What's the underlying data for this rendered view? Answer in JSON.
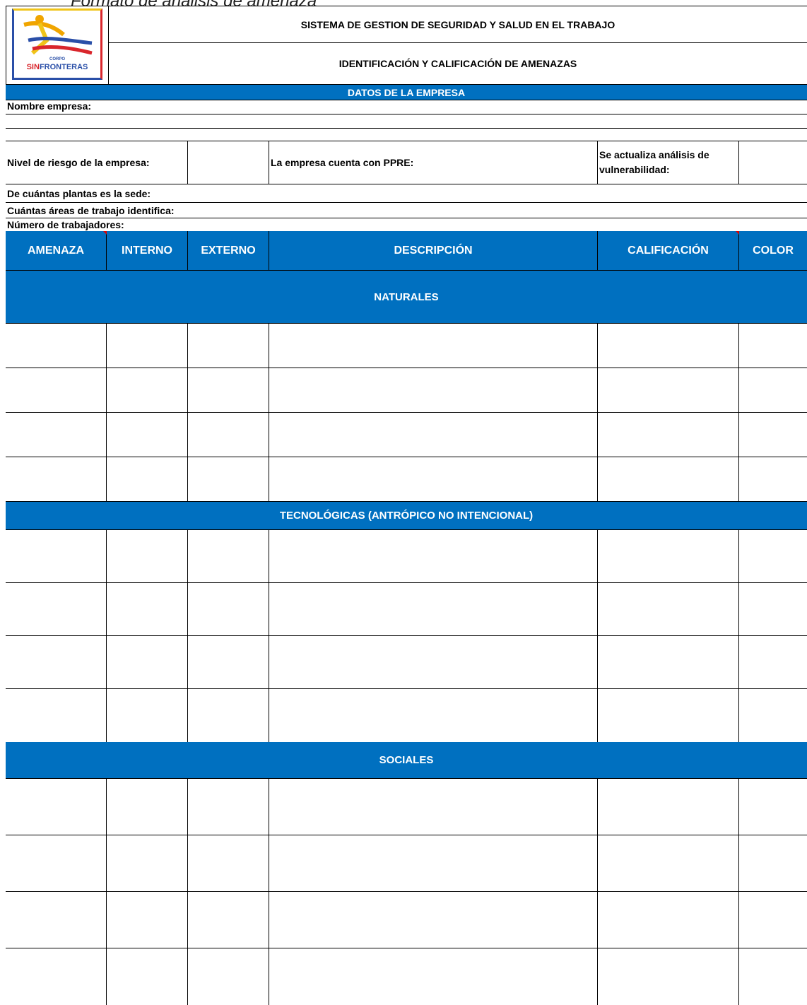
{
  "doc_title": "Formato de análisis de amenaza",
  "header": {
    "logo_small": "CORPO",
    "logo_sin": "SIN",
    "logo_fronteras": "FRONTERAS",
    "title": "SISTEMA DE GESTION DE SEGURIDAD Y SALUD EN EL TRABAJO",
    "subtitle": "IDENTIFICACIÓN Y CALIFICACIÓN DE AMENAZAS"
  },
  "company": {
    "section_title": "DATOS DE LA EMPRESA",
    "name_label": "Nombre empresa:",
    "risk_label": "Nivel de riesgo de la empresa:",
    "ppre_label": "La empresa cuenta con PPRE:",
    "vuln_label": "Se actualiza análisis de vulnerabilidad:",
    "plants_label": "De cuántas plantas es la sede:",
    "areas_label": "Cuántas áreas de trabajo identifica:",
    "workers_label": "Número de trabajadores:"
  },
  "table": {
    "columns": [
      "AMENAZA",
      "INTERNO",
      "EXTERNO",
      "DESCRIPCIÓN",
      "CALIFICACIÓN",
      "COLOR"
    ],
    "sections": [
      "NATURALES",
      "TECNOLÓGICAS (ANTRÓPICO NO INTENCIONAL)",
      "SOCIALES"
    ]
  }
}
